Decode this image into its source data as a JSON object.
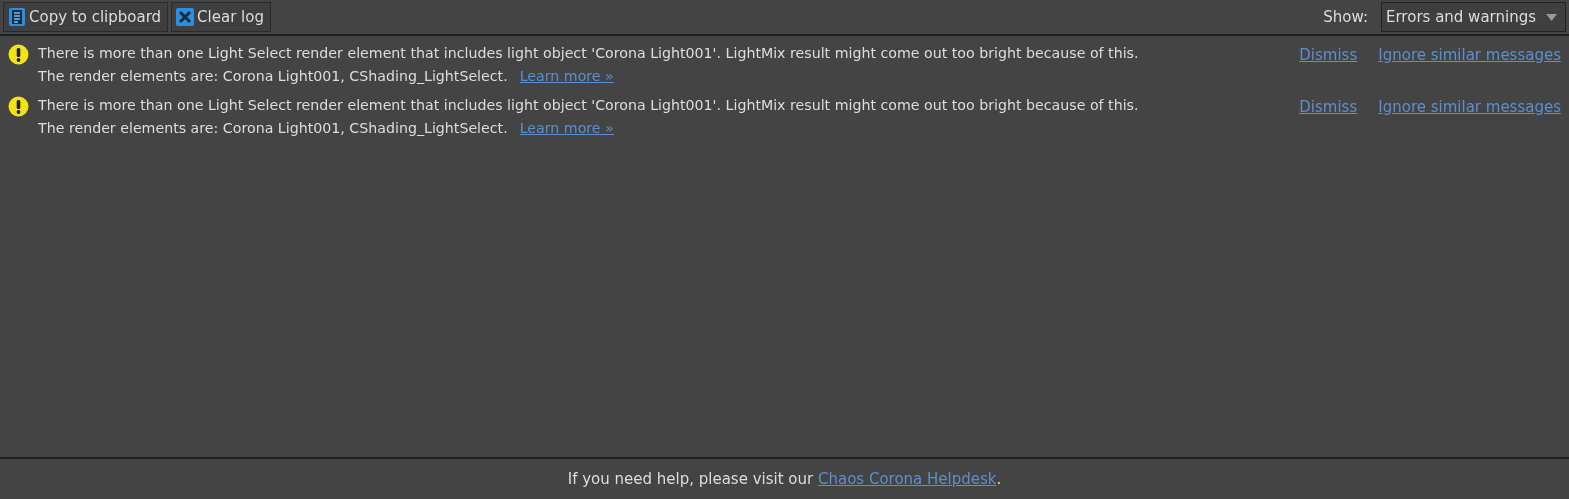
{
  "toolbar": {
    "buttons": [
      {
        "kind": "copy",
        "label": "Copy to clipboard"
      },
      {
        "kind": "clear",
        "label": "Clear log"
      }
    ],
    "filter": {
      "label": "Show:",
      "value": "Errors and warnings"
    }
  },
  "messages": [
    {
      "kind": "warning",
      "line1": "There is more than one Light Select render element that includes light object 'Corona Light001'. LightMix result might come out too bright because of this.",
      "line2": "The render elements are: Corona Light001, CShading_LightSelect.",
      "link": "Learn more »",
      "actions": [
        "Dismiss",
        "Ignore similar messages"
      ]
    },
    {
      "kind": "warning",
      "line1": "There is more than one Light Select render element that includes light object 'Corona Light001'. LightMix result might come out too bright because of this.",
      "line2": "The render elements are: Corona Light001, CShading_LightSelect.",
      "link": "Learn more »",
      "actions": [
        "Dismiss",
        "Ignore similar messages"
      ]
    }
  ],
  "footer": {
    "text": "If you need help, please visit our ",
    "link": "Chaos Corona Helpdesk",
    "end": "."
  }
}
